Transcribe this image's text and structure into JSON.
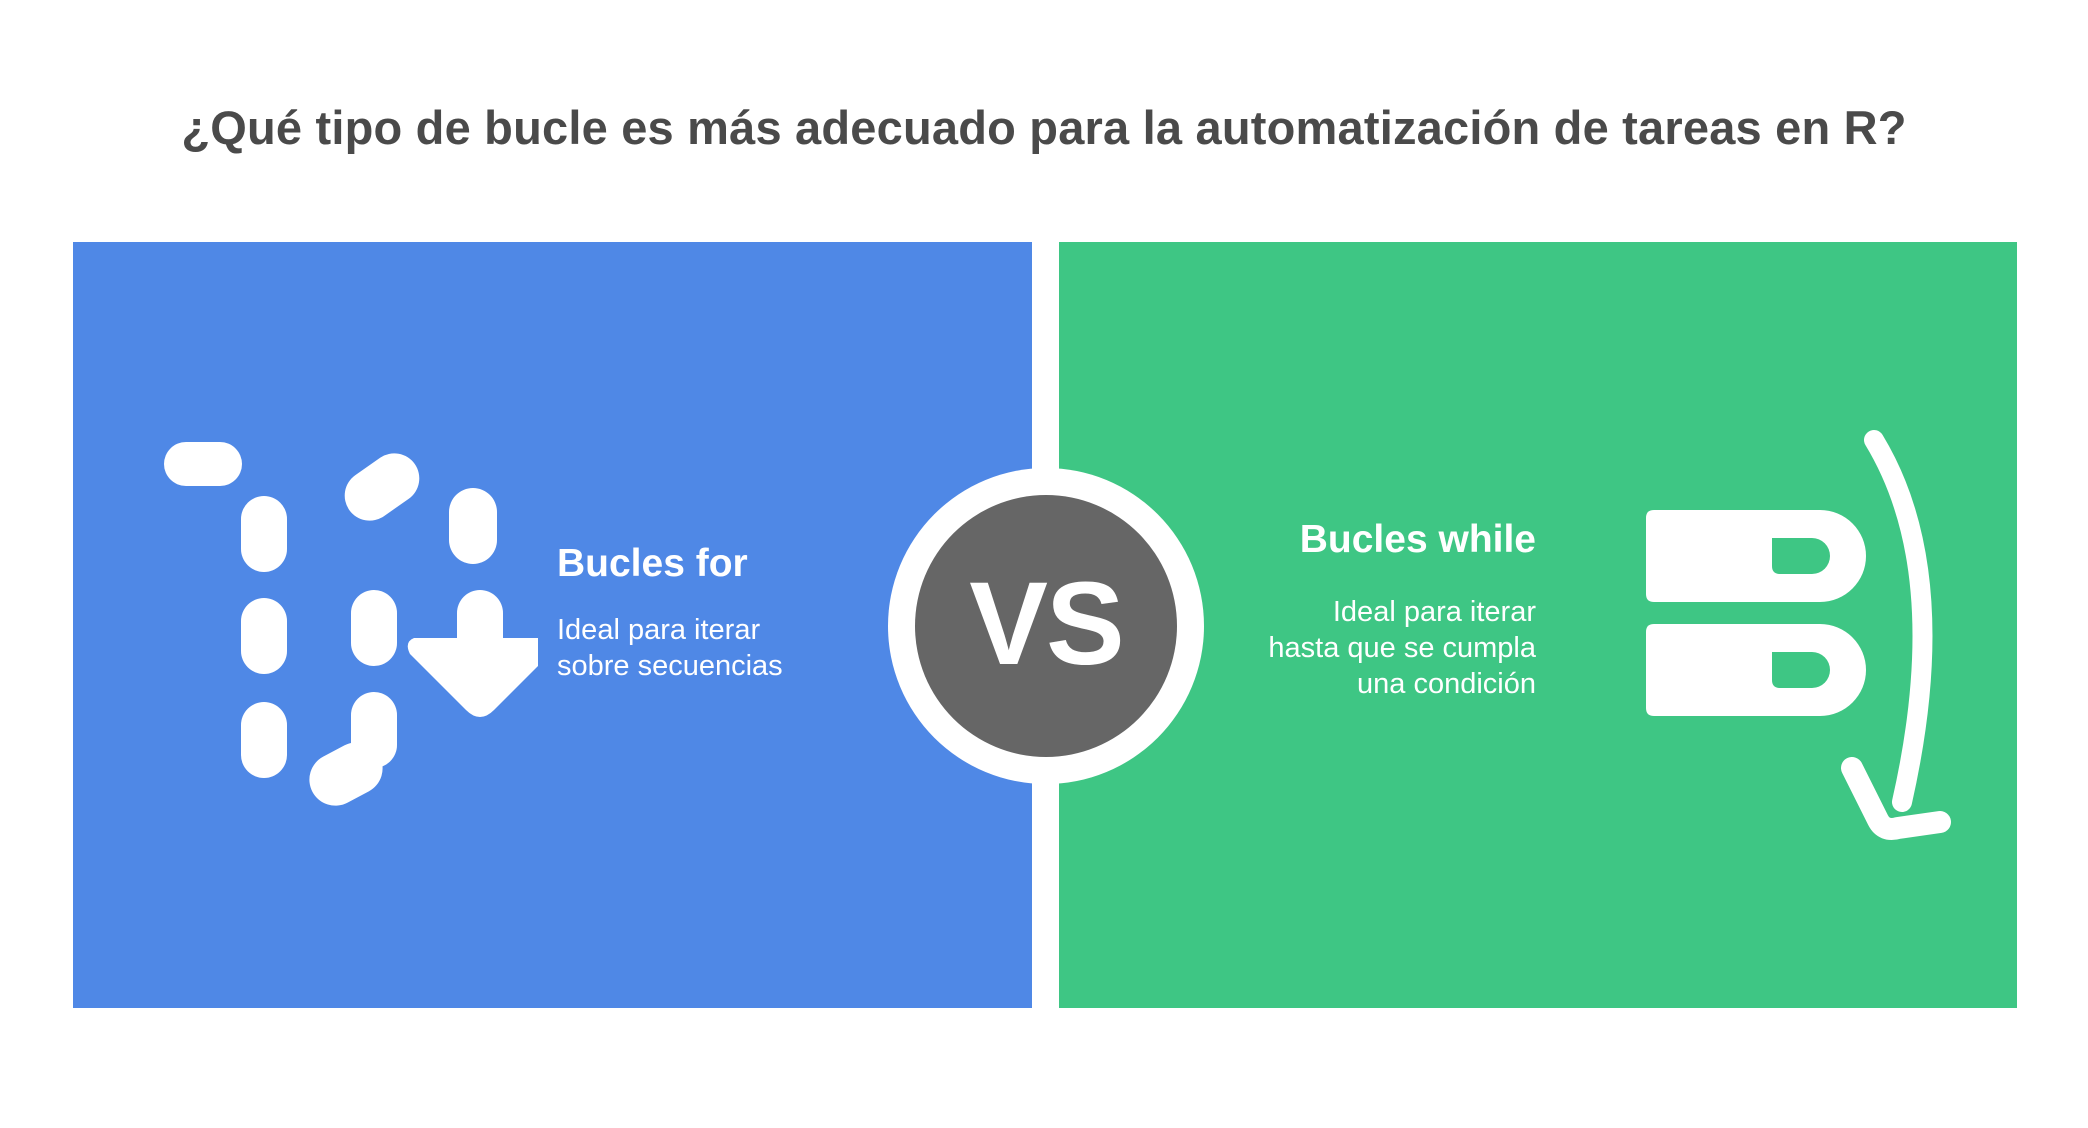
{
  "title": "¿Qué tipo de bucle es más adecuado para la automatización de tareas en R?",
  "left": {
    "heading": "Bucles for",
    "description": "Ideal para iterar\nsobre secuencias",
    "color": "#4f88e6",
    "icon": "dashed-path-down-arrow-icon"
  },
  "vs": {
    "label": "VS",
    "color": "#666666"
  },
  "right": {
    "heading": "Bucles while",
    "description": "Ideal para iterar\nhasta que se cumpla\nuna condición",
    "color": "#3ec684",
    "icon": "repeat-loop-icon"
  }
}
